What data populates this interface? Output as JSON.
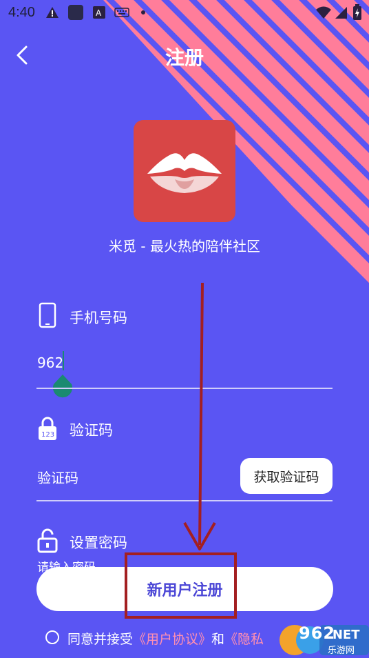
{
  "status_bar": {
    "time": "4:40",
    "left_icons": [
      "warning-icon",
      "app-icon",
      "font-icon",
      "keyboard-icon",
      "dot-icon"
    ],
    "right_icons": [
      "wifi-icon",
      "signal-icon",
      "battery-icon"
    ]
  },
  "header": {
    "title": "注册",
    "back_icon": "chevron-left-icon"
  },
  "app": {
    "logo_icon": "mouth-logo-icon",
    "tagline": "米觅 - 最火热的陪伴社区"
  },
  "form": {
    "phone": {
      "label": "手机号码",
      "icon": "phone-icon",
      "value": "962"
    },
    "code": {
      "label": "验证码",
      "icon": "lock-123-icon",
      "value": "验证码",
      "get_code_label": "获取验证码"
    },
    "password": {
      "label": "设置密码",
      "icon": "unlock-icon",
      "hint": "请输入密码"
    }
  },
  "register_button": {
    "label": "新用户注册"
  },
  "agreement": {
    "prefix": "同意并接受",
    "user_agreement": "《用户协议》",
    "and": "和",
    "privacy": "《隐私"
  },
  "watermark": {
    "number": "962",
    "domain": ".NET",
    "name": "乐游网"
  },
  "colors": {
    "background": "#5a55f3",
    "stripe": "#ff7d9a",
    "logo_bg": "#d84646",
    "annotation": "#a31f21",
    "link": "#ff8fb1"
  }
}
